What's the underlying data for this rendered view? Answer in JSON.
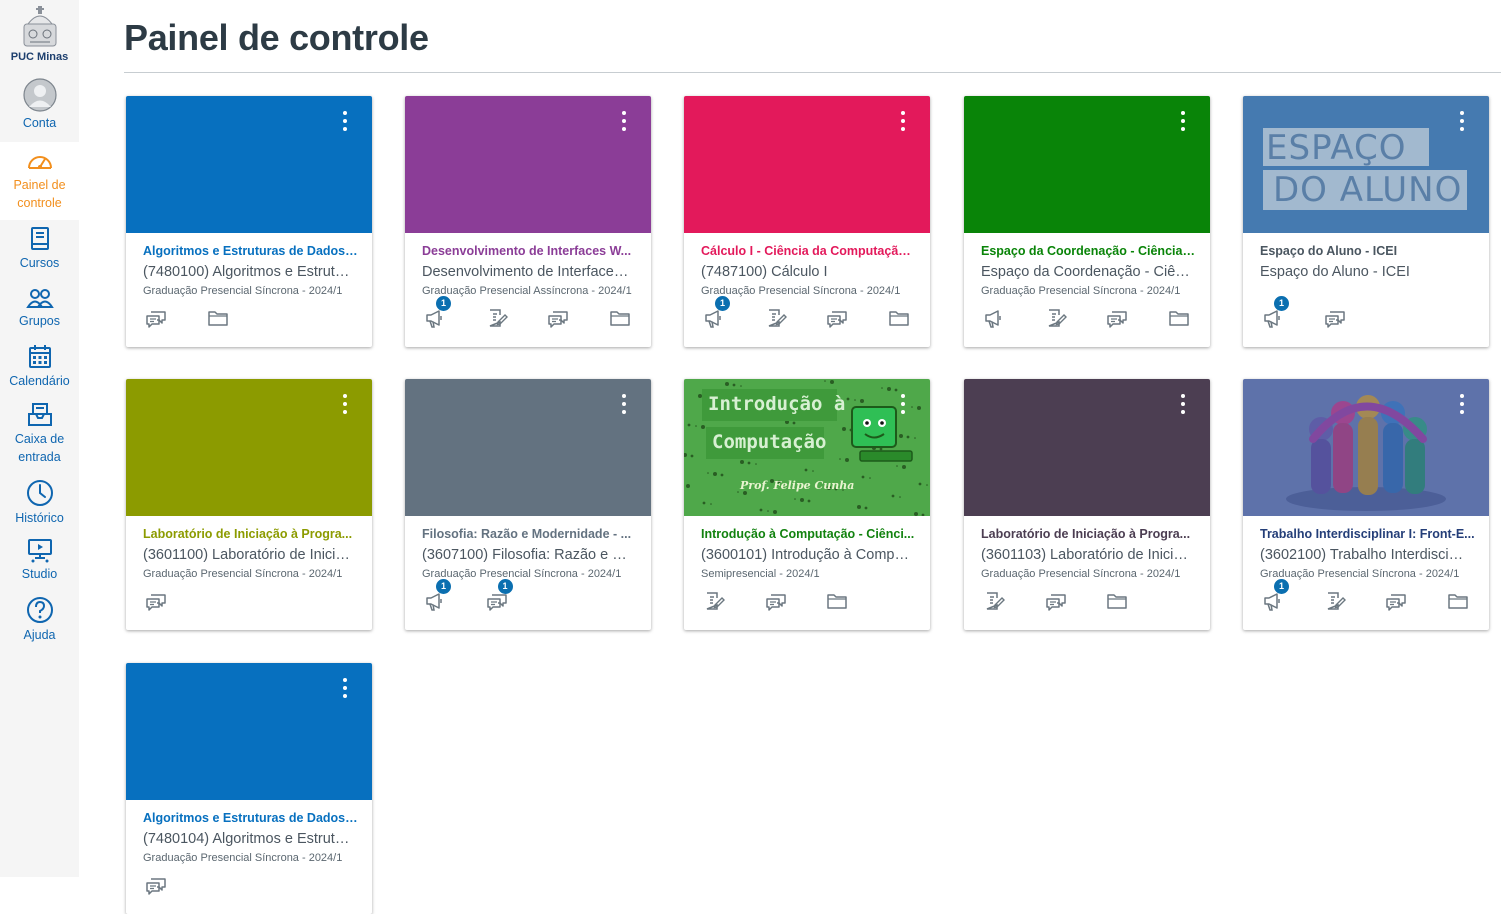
{
  "brand": {
    "name": "PUC Minas",
    "accent": "#f28f1d",
    "link_color": "#0f66b0"
  },
  "nav": {
    "items": [
      {
        "label": "Conta",
        "icon": "account-avatar-icon"
      },
      {
        "label": "Painel de controle",
        "icon": "dashboard-icon",
        "active": true
      },
      {
        "label": "Cursos",
        "icon": "courses-icon"
      },
      {
        "label": "Grupos",
        "icon": "groups-icon"
      },
      {
        "label": "Calendário",
        "icon": "calendar-icon"
      },
      {
        "label": "Caixa de entrada",
        "icon": "inbox-icon"
      },
      {
        "label": "Histórico",
        "icon": "history-icon"
      },
      {
        "label": "Studio",
        "icon": "studio-icon"
      },
      {
        "label": "Ajuda",
        "icon": "help-icon"
      }
    ]
  },
  "page": {
    "title": "Painel de controle"
  },
  "cards": [
    {
      "title": "Algoritmos e Estruturas de Dados ...",
      "code": "(7480100) Algoritmos e Estrut…",
      "term": "Graduação Presencial Síncrona - 2024/1",
      "color": "#0770bf",
      "image": "none",
      "actions": [
        {
          "icon": "discussions-icon",
          "badge": ""
        },
        {
          "icon": "files-icon",
          "badge": ""
        }
      ]
    },
    {
      "title": "Desenvolvimento de Interfaces W...",
      "code": "Desenvolvimento de Interface…",
      "term": "Graduação Presencial Assíncrona - 2024/1",
      "color": "#8b3d97",
      "image": "none",
      "actions": [
        {
          "icon": "announcements-icon",
          "badge": "1"
        },
        {
          "icon": "assignments-icon",
          "badge": ""
        },
        {
          "icon": "discussions-icon",
          "badge": ""
        },
        {
          "icon": "files-icon",
          "badge": ""
        }
      ]
    },
    {
      "title": "Cálculo I - Ciência da Computação...",
      "code": "(7487100) Cálculo I",
      "term": "Graduação Presencial Síncrona - 2024/1",
      "color": "#e3195b",
      "image": "none",
      "actions": [
        {
          "icon": "announcements-icon",
          "badge": "1"
        },
        {
          "icon": "assignments-icon",
          "badge": ""
        },
        {
          "icon": "discussions-icon",
          "badge": ""
        },
        {
          "icon": "files-icon",
          "badge": ""
        }
      ]
    },
    {
      "title": "Espaço da Coordenação - Ciência ...",
      "code": "Espaço da Coordenação - Ciên…",
      "term": "Graduação Presencial Síncrona - 2024/1",
      "color": "#098408",
      "image": "none",
      "actions": [
        {
          "icon": "announcements-icon",
          "badge": ""
        },
        {
          "icon": "assignments-icon",
          "badge": ""
        },
        {
          "icon": "discussions-icon",
          "badge": ""
        },
        {
          "icon": "files-icon",
          "badge": ""
        }
      ]
    },
    {
      "title": "Espaço do Aluno - ICEI",
      "code": "Espaço do Aluno - ICEI",
      "term": "",
      "color": "#4a7fb6",
      "image": "espaco",
      "image_text": [
        "ESPAÇO",
        "DO ALUNO"
      ],
      "actions": [
        {
          "icon": "announcements-icon",
          "badge": "1"
        },
        {
          "icon": "discussions-icon",
          "badge": ""
        }
      ]
    },
    {
      "title": "Laboratório de Iniciação à Progra...",
      "code": "(3601100) Laboratório de Inici…",
      "term": "Graduação Presencial Síncrona - 2024/1",
      "color": "#8c9b00",
      "image": "none",
      "actions": [
        {
          "icon": "discussions-icon",
          "badge": ""
        }
      ]
    },
    {
      "title": "Filosofia: Razão e Modernidade - ...",
      "code": "(3607100) Filosofia: Razão e …",
      "term": "Graduação Presencial Síncrona - 2024/1",
      "color": "#637280",
      "image": "none",
      "actions": [
        {
          "icon": "announcements-icon",
          "badge": "1"
        },
        {
          "icon": "discussions-icon",
          "badge": "1"
        }
      ]
    },
    {
      "title": "Introdução à Computação - Ciênci...",
      "code": "(3600101) Introdução à Comp…",
      "term": "Semipresencial - 2024/1",
      "color": "#12820f",
      "image": "intro",
      "image_text": [
        "Introdução à",
        "Computação",
        "Prof. Felipe Cunha"
      ],
      "actions": [
        {
          "icon": "assignments-icon",
          "badge": ""
        },
        {
          "icon": "discussions-icon",
          "badge": ""
        },
        {
          "icon": "files-icon",
          "badge": ""
        }
      ]
    },
    {
      "title": "Laboratório de Iniciação à Progra...",
      "code": "(3601103) Laboratório de Inici…",
      "term": "Graduação Presencial Síncrona - 2024/1",
      "color": "#4c3e52",
      "image": "none",
      "actions": [
        {
          "icon": "assignments-icon",
          "badge": ""
        },
        {
          "icon": "discussions-icon",
          "badge": ""
        },
        {
          "icon": "files-icon",
          "badge": ""
        }
      ]
    },
    {
      "title": "Trabalho Interdisciplinar I: Front-E...",
      "code": "(3602100) Trabalho Interdisci…",
      "term": "Graduação Presencial Síncrona - 2024/1",
      "color": "#243e78",
      "image": "team",
      "actions": [
        {
          "icon": "announcements-icon",
          "badge": "1"
        },
        {
          "icon": "assignments-icon",
          "badge": ""
        },
        {
          "icon": "discussions-icon",
          "badge": ""
        },
        {
          "icon": "files-icon",
          "badge": ""
        }
      ]
    },
    {
      "title": "Algoritmos e Estruturas de Dados ...",
      "code": "(7480104) Algoritmos e Estrut…",
      "term": "Graduação Presencial Síncrona - 2024/1",
      "color": "#0770bf",
      "image": "none",
      "actions": [
        {
          "icon": "discussions-icon",
          "badge": ""
        }
      ]
    }
  ]
}
